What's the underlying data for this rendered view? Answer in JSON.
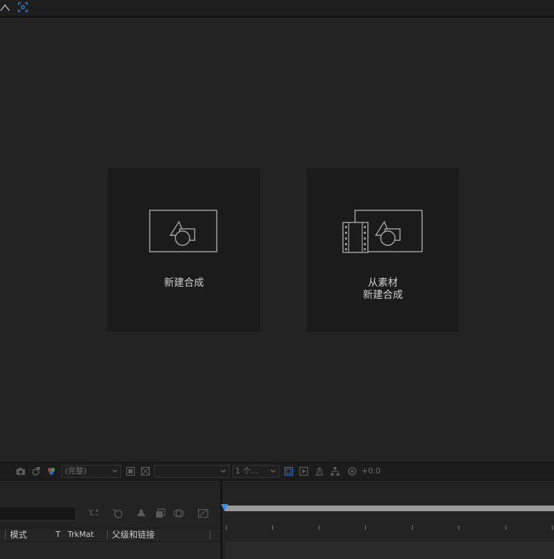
{
  "viewer": {
    "tiles": [
      {
        "id": "new-composition",
        "lines": [
          "新建合成"
        ]
      },
      {
        "id": "new-composition-from-footage",
        "lines": [
          "从素材",
          "新建合成"
        ]
      }
    ]
  },
  "viewer_footer": {
    "resolution_value": "(完整)",
    "views_value": "1 个...",
    "exposure_value": "+0.0"
  },
  "timeline": {
    "columns": {
      "mode": "模式",
      "track_matte_t": "T",
      "trkmat": "TrkMat",
      "parent_link": "父级和链接"
    }
  },
  "colors": {
    "accent": "#3a8ee6",
    "background": "#232323",
    "tile": "#1b1b1b"
  }
}
